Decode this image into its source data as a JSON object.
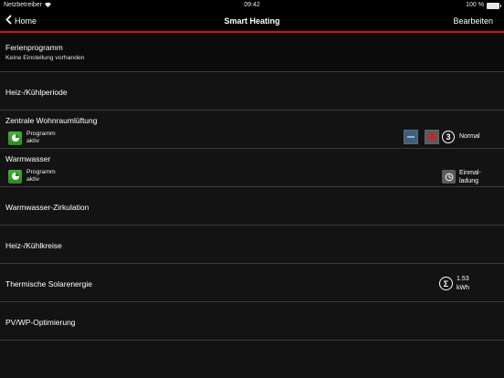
{
  "status_bar": {
    "carrier": "Netzbetreiber",
    "time": "09:42",
    "battery": "100 %"
  },
  "nav": {
    "back_label": "Home",
    "title": "Smart Heating",
    "edit_label": "Bearbeiten"
  },
  "rows": {
    "holiday": {
      "title": "Ferienprogramm",
      "subtitle": "Keine Einstellung vorhanden"
    },
    "heat_cool_period": {
      "title": "Heiz-/Kühlperiode"
    },
    "ventilation": {
      "title": "Zentrale Wohnraumlüftung",
      "program_line1": "Programm",
      "program_line2": "aktiv",
      "level": "3",
      "level_label": "Normal"
    },
    "hot_water": {
      "title": "Warmwasser",
      "program_line1": "Programm",
      "program_line2": "aktiv",
      "once_line1": "Einmal-",
      "once_line2": "ladung"
    },
    "circulation": {
      "title": "Warmwasser-Zirkulation"
    },
    "circuits": {
      "title": "Heiz-/Kühlkreise"
    },
    "solar": {
      "title": "Thermische Solarenergie",
      "value": "1.53",
      "unit": "kWh"
    },
    "pv": {
      "title": "PV/WP-Optimierung"
    }
  },
  "colors": {
    "accent_red": "#d0141b",
    "program_green": "#3aa22f",
    "minus_blue": "#3d5f7e"
  }
}
